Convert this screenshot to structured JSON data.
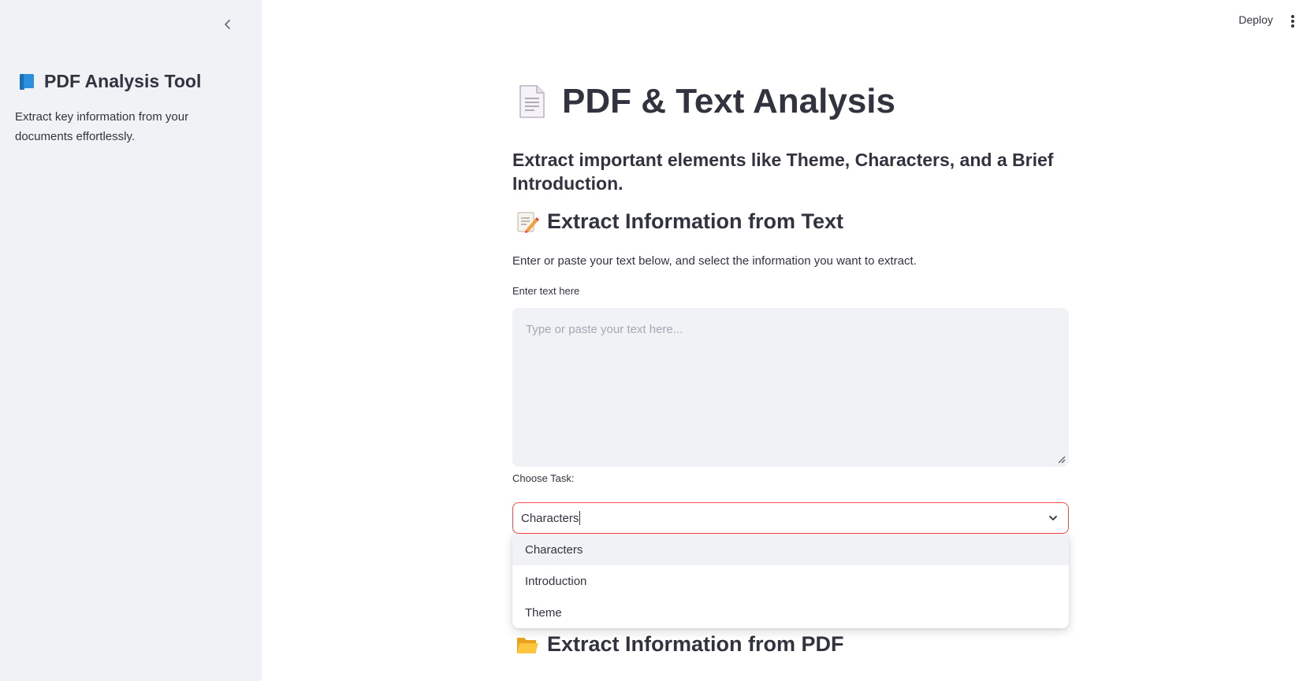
{
  "sidebar": {
    "title": "PDF Analysis Tool",
    "title_icon": "blue-book-icon",
    "description": "Extract key information from your documents effortlessly."
  },
  "toolbar": {
    "deploy_label": "Deploy"
  },
  "main": {
    "title": "PDF & Text Analysis",
    "title_icon": "page-document-icon",
    "subtitle": "Extract important elements like Theme, Characters, and a Brief Introduction.",
    "text_section": {
      "heading": "Extract Information from Text",
      "heading_icon": "memo-icon",
      "instructions": "Enter or paste your text below, and select the information you want to extract.",
      "text_label": "Enter text here",
      "text_placeholder": "Type or paste your text here...",
      "text_value": "",
      "task_label": "Choose Task:",
      "task_value": "Characters",
      "task_options": [
        "Characters",
        "Introduction",
        "Theme"
      ]
    },
    "pdf_section": {
      "heading": "Extract Information from PDF",
      "heading_icon": "open-folder-icon"
    }
  },
  "colors": {
    "sidebar_bg": "#f0f2f6",
    "text": "#31333f",
    "accent": "#ff4b4b",
    "input_bg": "#f0f2f6",
    "placeholder": "#a3a8b4"
  }
}
